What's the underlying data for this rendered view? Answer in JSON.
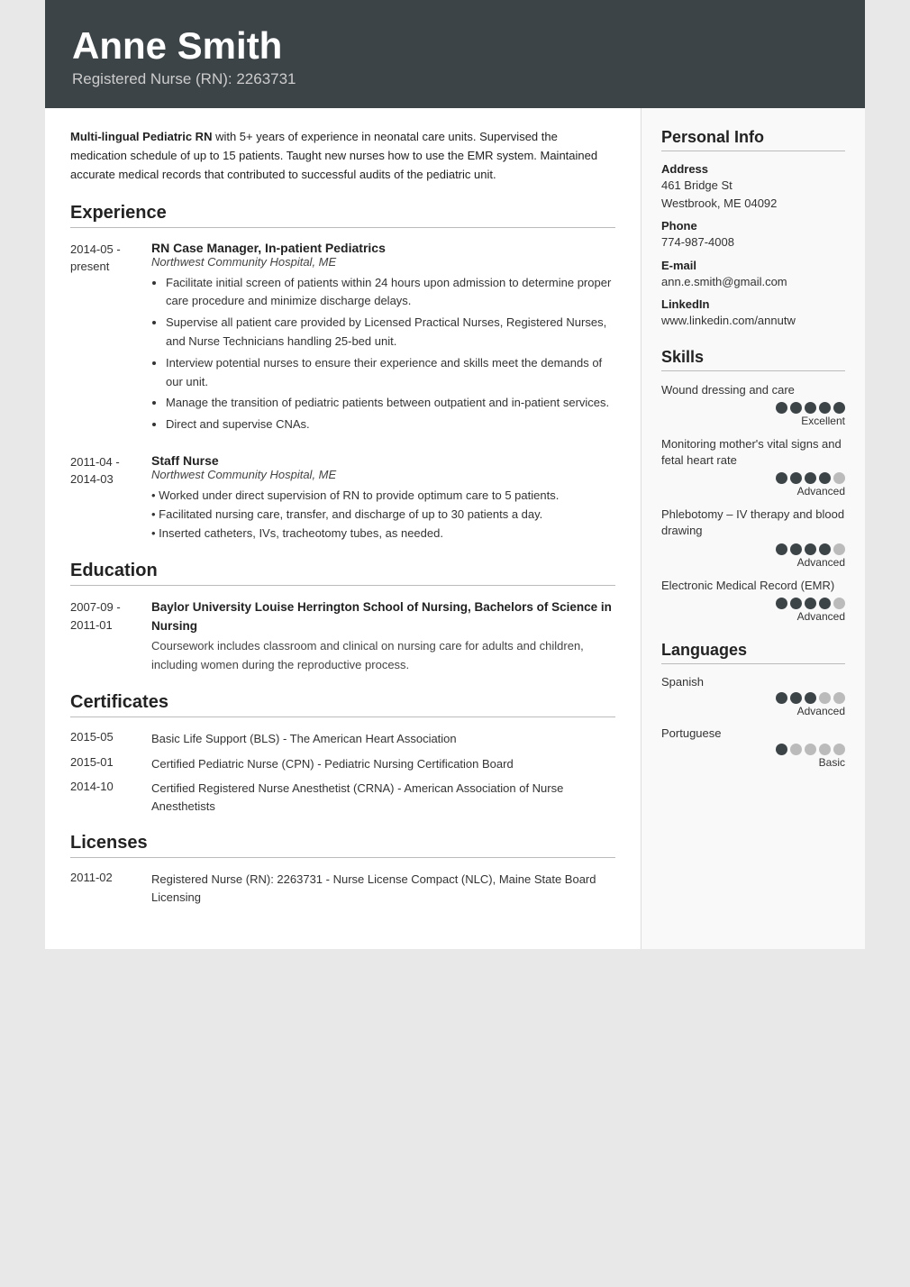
{
  "header": {
    "name": "Anne Smith",
    "subtitle": "Registered Nurse (RN): 2263731"
  },
  "summary": "Multi-lingual Pediatric RN with 5+ years of experience in neonatal care units. Supervised the medication schedule of up to 15 patients. Taught new nurses how to use the EMR system. Maintained accurate medical records that contributed to successful audits of the pediatric unit.",
  "sections": {
    "experience_label": "Experience",
    "education_label": "Education",
    "certificates_label": "Certificates",
    "licenses_label": "Licenses"
  },
  "experience": [
    {
      "date": "2014-05 -\npresent",
      "title": "RN Case Manager, In-patient Pediatrics",
      "company": "Northwest Community Hospital, ME",
      "bullets": [
        "Facilitate initial screen of patients within 24 hours upon admission to determine proper care procedure and minimize discharge delays.",
        "Supervise all patient care provided by Licensed Practical Nurses, Registered Nurses, and Nurse Technicians handling 25-bed unit.",
        "Interview potential nurses to ensure their experience and skills meet the demands of our unit.",
        "Manage the transition of pediatric patients between outpatient and in-patient services.",
        "Direct and supervise CNAs."
      ],
      "text": ""
    },
    {
      "date": "2011-04 -\n2014-03",
      "title": "Staff Nurse",
      "company": "Northwest Community Hospital, ME",
      "bullets": [],
      "text": "• Worked under direct supervision of RN to provide optimum care to 5 patients.\n• Facilitated nursing care, transfer, and discharge of up to 30 patients a day.\n• Inserted catheters, IVs, tracheotomy tubes, as needed."
    }
  ],
  "education": [
    {
      "date": "2007-09 -\n2011-01",
      "title": "Baylor University Louise Herrington School of Nursing, Bachelors of Science in Nursing",
      "desc": "Coursework includes classroom and clinical on nursing care for adults and children, including women during the reproductive process."
    }
  ],
  "certificates": [
    {
      "date": "2015-05",
      "text": "Basic Life Support (BLS) - The American Heart Association"
    },
    {
      "date": "2015-01",
      "text": "Certified Pediatric Nurse (CPN) - Pediatric Nursing Certification Board"
    },
    {
      "date": "2014-10",
      "text": "Certified Registered Nurse Anesthetist (CRNA) - American Association of Nurse Anesthetists"
    }
  ],
  "licenses": [
    {
      "date": "2011-02",
      "text": "Registered Nurse (RN): 2263731 - Nurse License Compact (NLC), Maine State Board Licensing"
    }
  ],
  "sidebar": {
    "personal_info_label": "Personal Info",
    "address_label": "Address",
    "address_line1": "461 Bridge St",
    "address_line2": "Westbrook, ME 04092",
    "phone_label": "Phone",
    "phone": "774-987-4008",
    "email_label": "E-mail",
    "email": "ann.e.smith@gmail.com",
    "linkedin_label": "LinkedIn",
    "linkedin": "www.linkedin.com/annutw",
    "skills_label": "Skills",
    "skills": [
      {
        "name": "Wound dressing and care",
        "filled": 5,
        "total": 5,
        "level": "Excellent"
      },
      {
        "name": "Monitoring mother's vital signs and fetal heart rate",
        "filled": 4,
        "total": 5,
        "level": "Advanced"
      },
      {
        "name": "Phlebotomy – IV therapy and blood drawing",
        "filled": 4,
        "total": 5,
        "level": "Advanced"
      },
      {
        "name": "Electronic Medical Record (EMR)",
        "filled": 4,
        "total": 5,
        "level": "Advanced"
      }
    ],
    "languages_label": "Languages",
    "languages": [
      {
        "name": "Spanish",
        "filled": 3,
        "total": 5,
        "level": "Advanced"
      },
      {
        "name": "Portuguese",
        "filled": 1,
        "total": 5,
        "level": "Basic"
      }
    ]
  }
}
